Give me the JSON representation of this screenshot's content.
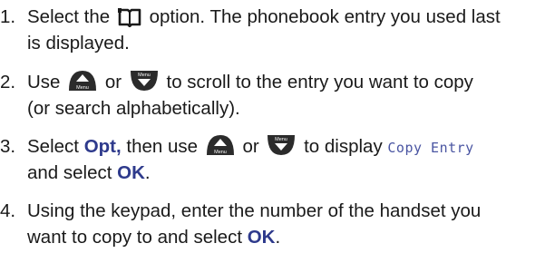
{
  "steps": [
    {
      "number": "1.",
      "line1_a": "Select the",
      "phonebook_icon": "phonebook-icon",
      "line1_b": "option. The phonebook entry you used last",
      "line2": "is displayed."
    },
    {
      "number": "2.",
      "line1_a": "Use",
      "up_icon": "nav-up-menu-key-icon",
      "or": "or",
      "down_icon": "nav-down-menu-key-icon",
      "line1_b": "to scroll to the entry you want to copy",
      "line2": "(or search alphabetically)."
    },
    {
      "number": "3.",
      "line1_a": "Select",
      "opt_label": "Opt,",
      "line1_b": "then use",
      "up_icon": "nav-up-menu-key-icon",
      "or": "or",
      "down_icon": "nav-down-menu-key-icon",
      "line1_c": "to display",
      "display_text": "Copy Entry",
      "line2_a": "and select",
      "ok_label": "OK",
      "line2_b": "."
    },
    {
      "number": "4.",
      "line1": "Using the keypad, enter the number of the handset you",
      "line2_a": "want to copy to and select",
      "ok_label": "OK",
      "line2_b": "."
    }
  ],
  "key_caption": "Menu",
  "colors": {
    "text": "#1a1a1a",
    "emphasis": "#2e3a8c",
    "lcd_text": "#4a55a2",
    "key_fill": "#2b2b2b"
  }
}
